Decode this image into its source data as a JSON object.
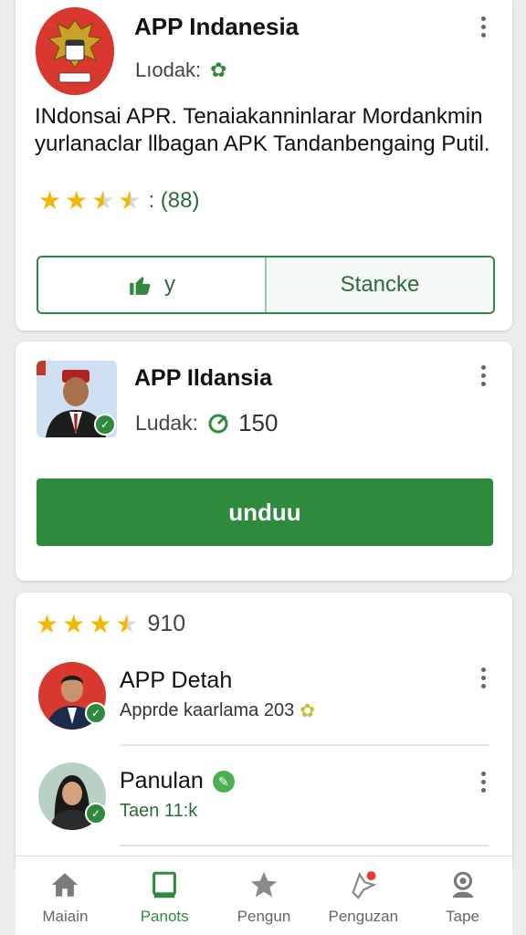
{
  "card1": {
    "title": "APP Indanesia",
    "subtitle": "Lıodak:",
    "description": "INdonsai APR. Tenaiakanninlarar Mordankmin yurlanaclar llbagan APK Tandanbengaing Putil.",
    "rating_count": ": (88)",
    "rating": 3.5,
    "like_label": "y",
    "secondary_label": "Stancke",
    "icons": {
      "verified": "gear-badge-icon",
      "like": "thumbs-up-icon",
      "menu": "kebab-icon"
    }
  },
  "card2": {
    "title": "APP Ildansia",
    "subtitle": "Ludak:",
    "count": "150",
    "download_label": "unduu",
    "icons": {
      "count": "refresh-icon",
      "menu": "kebab-icon"
    }
  },
  "card3": {
    "rating": 3.5,
    "rating_value": "910",
    "items": [
      {
        "title": "APP Detah",
        "subtitle": "Apprde kaarlama 203",
        "icon": "gear-badge-icon"
      },
      {
        "title": "Panulan",
        "subtitle": "Taen 11:k",
        "icon": "leaf-icon"
      }
    ]
  },
  "nav": {
    "items": [
      {
        "label": "Maiain",
        "icon": "home-icon"
      },
      {
        "label": "Panots",
        "icon": "square-icon",
        "active": true
      },
      {
        "label": "Pengun",
        "icon": "star-icon"
      },
      {
        "label": "Penguzan",
        "icon": "notification-icon"
      },
      {
        "label": "Tape",
        "icon": "person-icon"
      }
    ]
  },
  "colors": {
    "accent": "#2e8b3e",
    "star": "#f2b705",
    "emblem_bg": "#d8382e"
  }
}
